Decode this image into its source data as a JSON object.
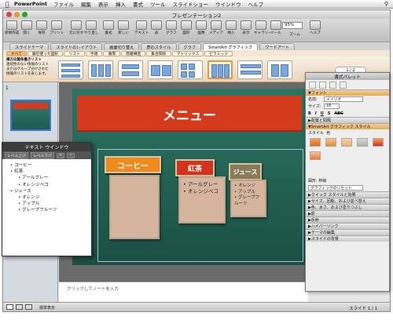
{
  "menubar": {
    "app": "PowerPoint",
    "items": [
      "ファイル",
      "編集",
      "表示",
      "挿入",
      "書式",
      "ツール",
      "スライドショー",
      "ウインドウ",
      "ヘルプ"
    ]
  },
  "window": {
    "title": "プレゼンテーション2"
  },
  "toolbar": {
    "buttons": [
      "新規作成",
      "開く",
      "保存",
      "プリント",
      "元に戻す",
      "やり直し",
      "書式",
      "新しい",
      "テキスト",
      "表",
      "グラフ",
      "図形",
      "画像",
      "メディア",
      "挿入",
      "表示",
      "ギャラリー",
      "ツール",
      "ズーム",
      "ヘルプ"
    ],
    "zoom": "95%"
  },
  "ribbon_tabs": [
    "スライドテーマ",
    "スライドのレイアウト",
    "画面切り替え",
    "表のスタイル",
    "グラフ",
    "SmartArt グラフィック",
    "ワードアート"
  ],
  "ribbon_active": "SmartArt グラフィック",
  "category_tabs": [
    "すべて",
    "最近使った図形",
    "リスト",
    "手順",
    "循環",
    "階層構造",
    "集合関係",
    "マトリックス",
    "ピラミッド"
  ],
  "ribbon_desc": {
    "title": "横方向箇条書きリスト",
    "text": "連続性のない情報のリストまたはグループ分けされた情報のリストを表します。"
  },
  "gallery_pager": "1 / 2",
  "slide": {
    "title": "メニュー",
    "cards": [
      {
        "head": "コーヒー",
        "items": []
      },
      {
        "head": "紅茶",
        "items": [
          "アールグレー",
          "オレンジペコ"
        ]
      },
      {
        "head": "ジュース",
        "items": [
          "オレンジ",
          "アップル",
          "グレープフルーツ"
        ]
      }
    ]
  },
  "text_window": {
    "title": "テキスト ウインドウ",
    "btn_up": "レベル上げ",
    "btn_down": "レベル下げ",
    "items": [
      {
        "level": 1,
        "text": "コーヒー"
      },
      {
        "level": 1,
        "text": "紅茶"
      },
      {
        "level": 2,
        "text": "アールグレー"
      },
      {
        "level": 2,
        "text": "オレンジペコ"
      },
      {
        "level": 1,
        "text": "ジュース"
      },
      {
        "level": 2,
        "text": "オレンジ"
      },
      {
        "level": 2,
        "text": "アップル"
      },
      {
        "level": 2,
        "text": "グレープフルーツ"
      }
    ]
  },
  "notes": {
    "placeholder": "クリックしてノートを入力"
  },
  "status": {
    "view": "標準表示",
    "slide": "スライド 1 / 1"
  },
  "palette": {
    "title": "書式パレット",
    "font_section": "フォント",
    "name_label": "名前:",
    "font_name": "メイリオ",
    "size_label": "サイズ:",
    "font_size": "18",
    "section2": "配置と間隔",
    "smartart_section": "SmartArt グラフィック スタイル",
    "style_label": "スタイル",
    "color_label": "色",
    "shape_label": "図形:",
    "border_label": "枠線",
    "reset_button": "グラフィックのリセット",
    "collapsed": [
      "クイック スタイルと効果",
      "サイズ、回転、および並べ替え",
      "色、太さ、および塗りつぶし",
      "影",
      "反射",
      "ハイパーリンク",
      "テーマの編集",
      "スライドの背景"
    ]
  },
  "colors": {
    "title_bar": "#d43a1c",
    "coffee": "#f08a1c",
    "tea": "#d4321a",
    "juice": "#8a7a5a",
    "slide_bg": "#2b7563"
  }
}
